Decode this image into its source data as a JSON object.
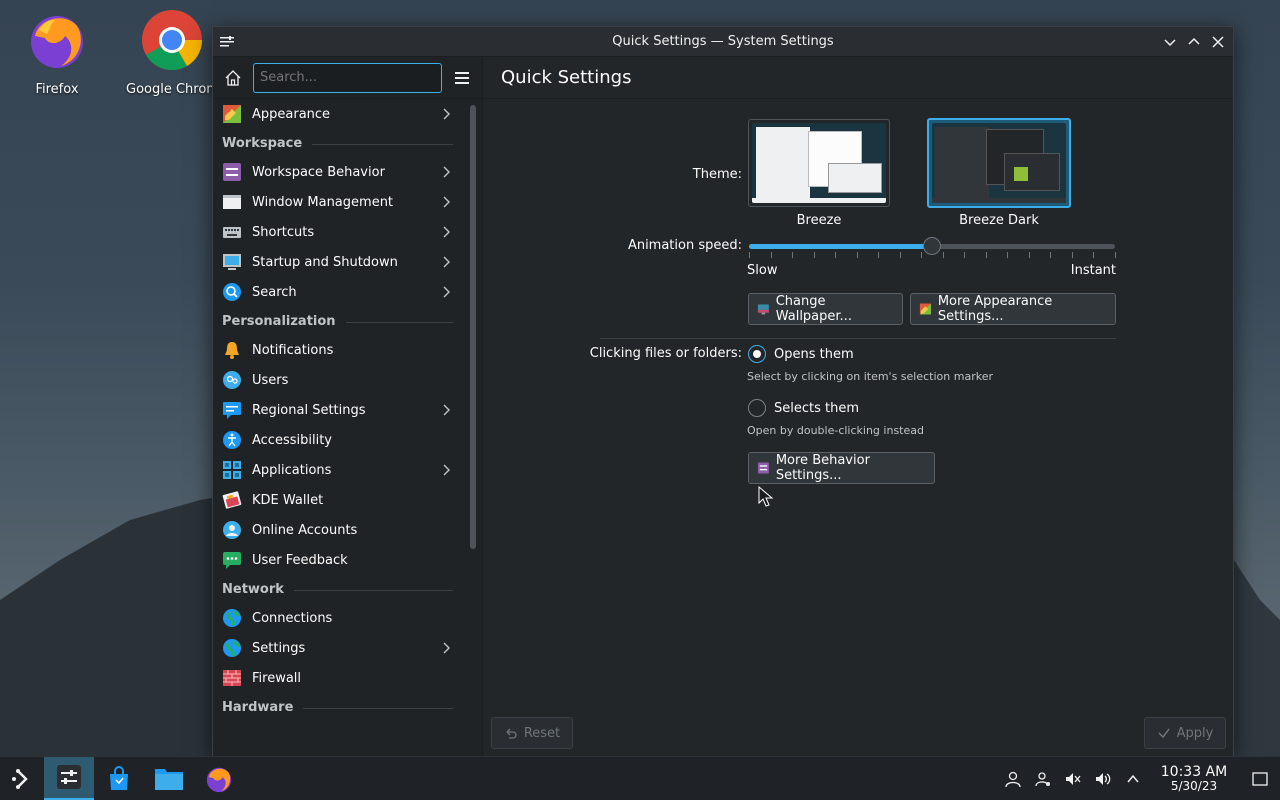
{
  "desktop": {
    "icons": [
      {
        "label": "Firefox"
      },
      {
        "label": "Google Chrome"
      }
    ]
  },
  "window": {
    "title": "Quick Settings — System Settings"
  },
  "sidebar": {
    "search_placeholder": "Search...",
    "items": [
      {
        "type": "item",
        "label": "Appearance",
        "chevron": true,
        "icon": "appearance-icon"
      },
      {
        "type": "heading",
        "label": "Workspace"
      },
      {
        "type": "item",
        "label": "Workspace Behavior",
        "chevron": true,
        "icon": "workspace-behavior-icon"
      },
      {
        "type": "item",
        "label": "Window Management",
        "chevron": true,
        "icon": "window-management-icon"
      },
      {
        "type": "item",
        "label": "Shortcuts",
        "chevron": true,
        "icon": "keyboard-icon"
      },
      {
        "type": "item",
        "label": "Startup and Shutdown",
        "chevron": true,
        "icon": "startup-icon"
      },
      {
        "type": "item",
        "label": "Search",
        "chevron": true,
        "icon": "search-icon"
      },
      {
        "type": "heading",
        "label": "Personalization"
      },
      {
        "type": "item",
        "label": "Notifications",
        "chevron": false,
        "icon": "bell-icon"
      },
      {
        "type": "item",
        "label": "Users",
        "chevron": false,
        "icon": "users-icon"
      },
      {
        "type": "item",
        "label": "Regional Settings",
        "chevron": true,
        "icon": "regional-icon"
      },
      {
        "type": "item",
        "label": "Accessibility",
        "chevron": false,
        "icon": "accessibility-icon"
      },
      {
        "type": "item",
        "label": "Applications",
        "chevron": true,
        "icon": "applications-icon"
      },
      {
        "type": "item",
        "label": "KDE Wallet",
        "chevron": false,
        "icon": "wallet-icon"
      },
      {
        "type": "item",
        "label": "Online Accounts",
        "chevron": false,
        "icon": "online-accounts-icon"
      },
      {
        "type": "item",
        "label": "User Feedback",
        "chevron": false,
        "icon": "feedback-icon"
      },
      {
        "type": "heading",
        "label": "Network"
      },
      {
        "type": "item",
        "label": "Connections",
        "chevron": false,
        "icon": "globe-icon"
      },
      {
        "type": "item",
        "label": "Settings",
        "chevron": true,
        "icon": "network-settings-icon"
      },
      {
        "type": "item",
        "label": "Firewall",
        "chevron": false,
        "icon": "firewall-icon"
      },
      {
        "type": "heading",
        "label": "Hardware"
      }
    ]
  },
  "main": {
    "title": "Quick Settings",
    "theme_label": "Theme:",
    "themes": [
      {
        "name": "Breeze",
        "selected": false
      },
      {
        "name": "Breeze Dark",
        "selected": true
      }
    ],
    "animation_label": "Animation speed:",
    "animation_speed": 0.5,
    "slow_label": "Slow",
    "instant_label": "Instant",
    "change_wallpaper": "Change Wallpaper...",
    "more_appearance": "More Appearance Settings...",
    "clicking_label": "Clicking files or folders:",
    "opens_label": "Opens them",
    "opens_hint": "Select by clicking on item's selection marker",
    "selects_label": "Selects them",
    "selects_hint": "Open by double-clicking instead",
    "more_behavior": "More Behavior Settings...",
    "reset": "Reset",
    "apply": "Apply"
  },
  "taskbar": {
    "time": "10:33 AM",
    "date": "5/30/23"
  },
  "colors": {
    "accent": "#3daee9",
    "window_bg": "#232629",
    "sidebar_bg": "#202326"
  }
}
